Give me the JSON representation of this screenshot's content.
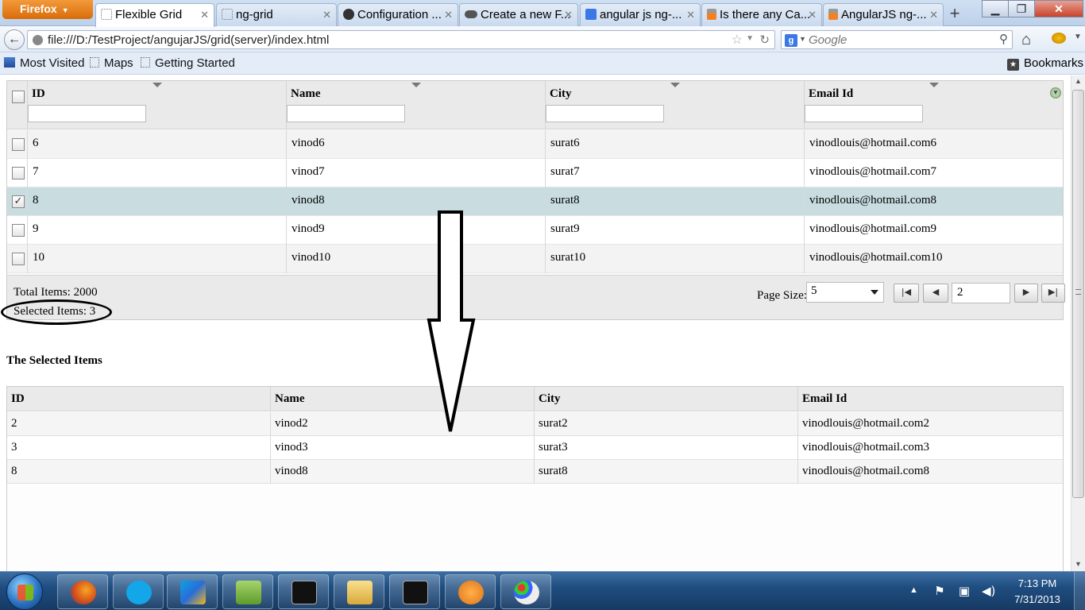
{
  "browser": {
    "app_button": "Firefox",
    "tabs": [
      {
        "label": "Flexible Grid",
        "icon": "blank-page-icon",
        "active": true
      },
      {
        "label": "ng-grid",
        "icon": "blank-page-icon"
      },
      {
        "label": "Configuration ...",
        "icon": "github-icon"
      },
      {
        "label": "Create a new F...",
        "icon": "cloud-icon"
      },
      {
        "label": "angular js ng-...",
        "icon": "google-icon"
      },
      {
        "label": "Is there any Ca...",
        "icon": "stackoverflow-icon"
      },
      {
        "label": "AngularJS ng-...",
        "icon": "stackoverflow-icon"
      }
    ],
    "new_tab": "+",
    "url": "file:///D:/TestProject/angujarJS/grid(server)/index.html",
    "search_engine": "Google",
    "search_placeholder": "Google",
    "bookmarks": [
      "Most Visited",
      "Maps",
      "Getting Started"
    ],
    "bookmarks_menu": "Bookmarks"
  },
  "grid": {
    "columns": [
      "ID",
      "Name",
      "City",
      "Email Id"
    ],
    "rows": [
      {
        "id": "6",
        "name": "vinod6",
        "city": "surat6",
        "email": "vinodlouis@hotmail.com6",
        "checked": false
      },
      {
        "id": "7",
        "name": "vinod7",
        "city": "surat7",
        "email": "vinodlouis@hotmail.com7",
        "checked": false
      },
      {
        "id": "8",
        "name": "vinod8",
        "city": "surat8",
        "email": "vinodlouis@hotmail.com8",
        "checked": true
      },
      {
        "id": "9",
        "name": "vinod9",
        "city": "surat9",
        "email": "vinodlouis@hotmail.com9",
        "checked": false
      },
      {
        "id": "10",
        "name": "vinod10",
        "city": "surat10",
        "email": "vinodlouis@hotmail.com10",
        "checked": false
      }
    ],
    "footer": {
      "total_items": "Total Items: 2000",
      "selected_items": "Selected Items: 3",
      "page_size_label": "Page Size:",
      "page_size_value": "5",
      "current_page": "2"
    }
  },
  "selected_section": {
    "title": "The Selected Items",
    "columns": [
      "ID",
      "Name",
      "City",
      "Email Id"
    ],
    "rows": [
      {
        "id": "2",
        "name": "vinod2",
        "city": "surat2",
        "email": "vinodlouis@hotmail.com2"
      },
      {
        "id": "3",
        "name": "vinod3",
        "city": "surat3",
        "email": "vinodlouis@hotmail.com3"
      },
      {
        "id": "8",
        "name": "vinod8",
        "city": "surat8",
        "email": "vinodlouis@hotmail.com8"
      }
    ]
  },
  "taskbar": {
    "apps": [
      "firefox-icon",
      "skype-icon",
      "webstorm-icon",
      "notepad-icon",
      "cmd-icon",
      "explorer-icon",
      "cmd-icon",
      "media-player-icon",
      "paint-icon"
    ],
    "time": "7:13 PM",
    "date": "7/31/2013"
  },
  "colors": {
    "selected_row": "#c9dde1",
    "header_bg": "#eaeaea",
    "taskbar": "#1f4d80",
    "firefox_button": "#e07a1a"
  }
}
